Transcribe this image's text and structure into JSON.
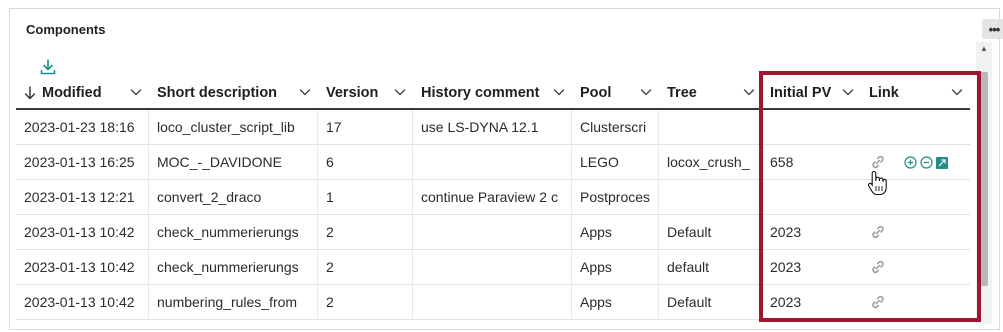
{
  "panel": {
    "title": "Components",
    "menu_icon": "ellipsis-icon",
    "download_icon": "download-icon"
  },
  "columns": [
    {
      "label": "Modified",
      "sorted": "descending"
    },
    {
      "label": "Short description"
    },
    {
      "label": "Version"
    },
    {
      "label": "History comment"
    },
    {
      "label": "Pool"
    },
    {
      "label": "Tree"
    },
    {
      "label": "Initial PV"
    },
    {
      "label": "Link"
    }
  ],
  "rows": [
    {
      "modified": "2023-01-23 18:16",
      "description": "loco_cluster_script_lib",
      "version": "17",
      "comment": "use LS-DYNA 12.1",
      "pool": "Clusterscri",
      "tree": "",
      "initial_pv": "",
      "link": false
    },
    {
      "modified": "2023-01-13 16:25",
      "description": "MOC_-_DAVIDONE",
      "version": "6",
      "comment": "",
      "pool": "LEGO",
      "tree": "locox_crush_",
      "initial_pv": "658",
      "link": true
    },
    {
      "modified": "2023-01-13 12:21",
      "description": "convert_2_draco",
      "version": "1",
      "comment": "continue Paraview 2 c",
      "pool": "Postproces",
      "tree": "",
      "initial_pv": "",
      "link": false
    },
    {
      "modified": "2023-01-13 10:42",
      "description": "check_nummerierungs",
      "version": "2",
      "comment": "",
      "pool": "Apps",
      "tree": "Default",
      "initial_pv": "2023",
      "link": true
    },
    {
      "modified": "2023-01-13 10:42",
      "description": "check_nummerierungs",
      "version": "2",
      "comment": "",
      "pool": "Apps",
      "tree": "default",
      "initial_pv": "2023",
      "link": true
    },
    {
      "modified": "2023-01-13 10:42",
      "description": "numbering_rules_from",
      "version": "2",
      "comment": "",
      "pool": "Apps",
      "tree": "Default",
      "initial_pv": "2023",
      "link": true
    }
  ],
  "row_actions": [
    "add-circle-icon",
    "remove-circle-icon",
    "expand-icon"
  ],
  "colors": {
    "accent": "#1e8f8a",
    "highlight": "#a0162f"
  }
}
